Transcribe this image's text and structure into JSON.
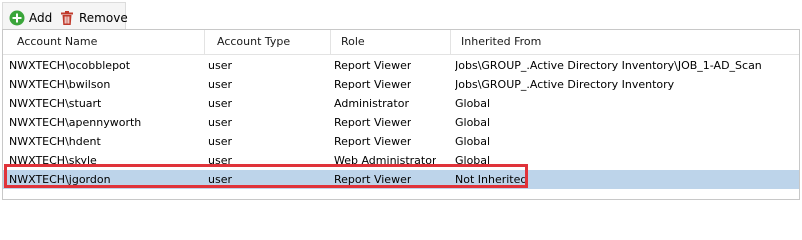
{
  "toolbar": {
    "add_label": "Add",
    "remove_label": "Remove",
    "add_icon": "plus-circle-icon",
    "remove_icon": "trash-icon",
    "add_color": "#3aa53a",
    "remove_color": "#c0392b"
  },
  "table": {
    "columns": [
      "Account Name",
      "Account Type",
      "Role",
      "Inherited From"
    ],
    "rows": [
      {
        "name": "NWXTECH\\ocobblepot",
        "type": "user",
        "role": "Report Viewer",
        "inherited": "Jobs\\GROUP_.Active Directory Inventory\\JOB_1-AD_Scan"
      },
      {
        "name": "NWXTECH\\bwilson",
        "type": "user",
        "role": "Report Viewer",
        "inherited": "Jobs\\GROUP_.Active Directory Inventory"
      },
      {
        "name": "NWXTECH\\stuart",
        "type": "user",
        "role": "Administrator",
        "inherited": "Global"
      },
      {
        "name": "NWXTECH\\apennyworth",
        "type": "user",
        "role": "Report Viewer",
        "inherited": "Global"
      },
      {
        "name": "NWXTECH\\hdent",
        "type": "user",
        "role": "Report Viewer",
        "inherited": "Global"
      },
      {
        "name": "NWXTECH\\skyle",
        "type": "user",
        "role": "Web Administrator",
        "inherited": "Global"
      },
      {
        "name": "NWXTECH\\jgordon",
        "type": "user",
        "role": "Report Viewer",
        "inherited": "Not Inherited"
      }
    ],
    "selected_index": 6,
    "selected_color": "#bdd4ea",
    "highlight_color": "#e0333a"
  }
}
